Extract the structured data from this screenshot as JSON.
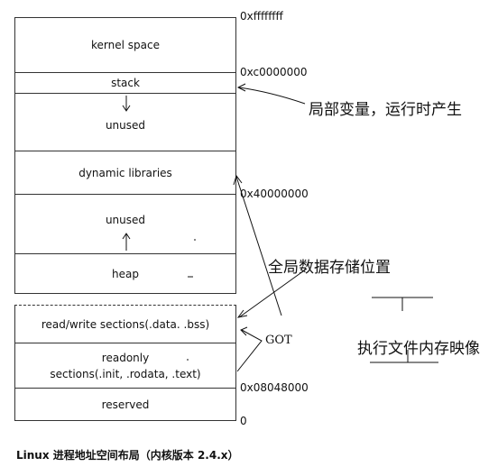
{
  "blocks": [
    {
      "label": "kernel space"
    },
    {
      "label": "stack"
    },
    {
      "label": "unused"
    },
    {
      "label": "dynamic libraries"
    },
    {
      "label": "unused"
    },
    {
      "label": "heap"
    },
    {
      "label": "read/write sections(.data. .bss)"
    },
    {
      "label": "readonly\nsections(.init, .rodata, .text)"
    },
    {
      "label": "reserved"
    }
  ],
  "addresses": {
    "top": "0xffffffff",
    "kernel": "0xc0000000",
    "libs": "0x40000000",
    "text": "0x08048000",
    "zero": "0"
  },
  "annotations": {
    "stack_note": "局部变量，运行时产生",
    "data_note": "全局数据存储位置",
    "got": "GOT",
    "image_note": "执行文件内存映像"
  },
  "caption": "Linux 进程地址空间布局（内核版本 2.4.x）"
}
